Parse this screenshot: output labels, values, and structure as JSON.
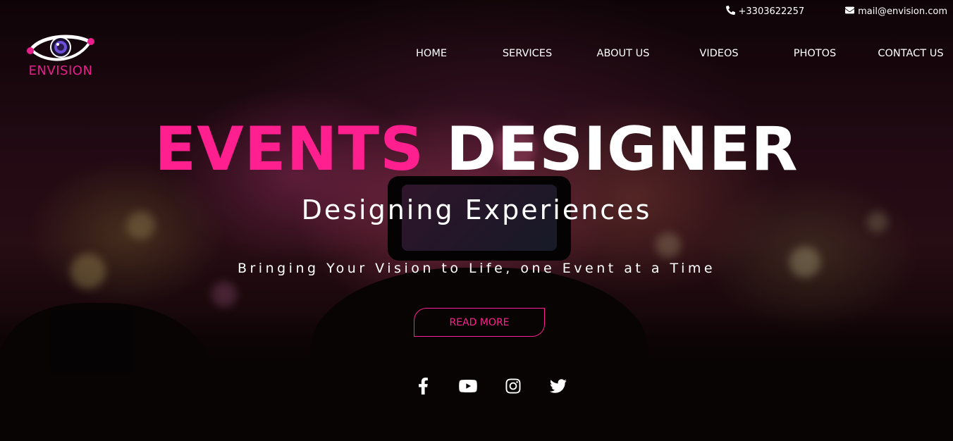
{
  "topbar": {
    "phone": "+3303622257",
    "email": "mail@envision.com"
  },
  "logo": {
    "text": "ENVISION"
  },
  "nav": {
    "items": [
      {
        "label": "HOME"
      },
      {
        "label": "SERVICES"
      },
      {
        "label": "ABOUT US"
      },
      {
        "label": "VIDEOS"
      },
      {
        "label": "PHOTOS"
      },
      {
        "label": "CONTACT US"
      }
    ]
  },
  "hero": {
    "title_pink": "EVENTS",
    "title_white": "DESIGNER",
    "subtitle": "Designing Experiences",
    "tagline": "Bringing Your Vision to Life, one Event at a Time",
    "cta_label": "READ MORE"
  },
  "social": [
    "facebook-icon",
    "youtube-icon",
    "instagram-icon",
    "twitter-icon"
  ],
  "colors": {
    "accent": "#ff1f8e",
    "logo": "#e91e8c",
    "text": "#ffffff"
  }
}
